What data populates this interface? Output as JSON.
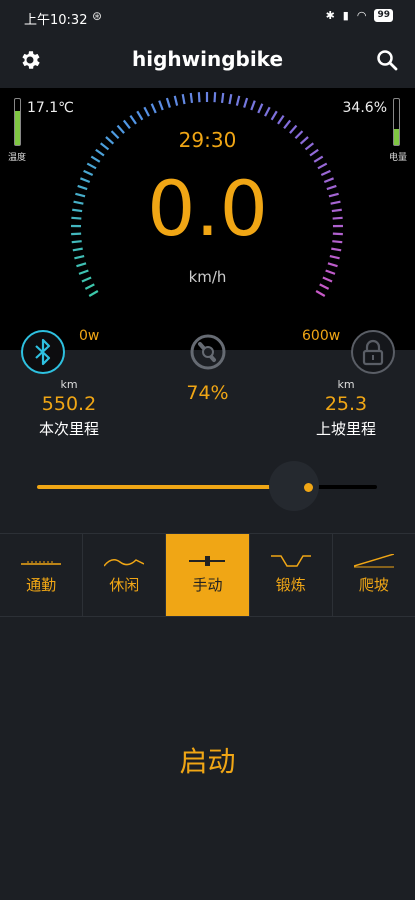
{
  "status_bar": {
    "time": "上午10:32",
    "alarm": "⊛",
    "battery": "99"
  },
  "app": {
    "title": "highwingbike"
  },
  "dashboard": {
    "temperature": "17.1℃",
    "temperature_label": "温度",
    "temperature_level": 0.75,
    "battery_pct": "34.6%",
    "battery_label": "电量",
    "battery_level": 0.35,
    "timer": "29:30",
    "speed": "0.0",
    "speed_unit": "km/h",
    "power_min": "0w",
    "power_max": "600w"
  },
  "stats": {
    "trip": {
      "unit": "km",
      "value": "550.2",
      "label": "本次里程"
    },
    "assist": {
      "value": "74%"
    },
    "climb": {
      "unit": "km",
      "value": "25.3",
      "label": "上坡里程"
    }
  },
  "slider": {
    "level": 0.74
  },
  "modes": [
    {
      "label": "通勤",
      "active": false
    },
    {
      "label": "休闲",
      "active": false
    },
    {
      "label": "手动",
      "active": true
    },
    {
      "label": "锻炼",
      "active": false
    },
    {
      "label": "爬坡",
      "active": false
    }
  ],
  "start_label": "启动"
}
